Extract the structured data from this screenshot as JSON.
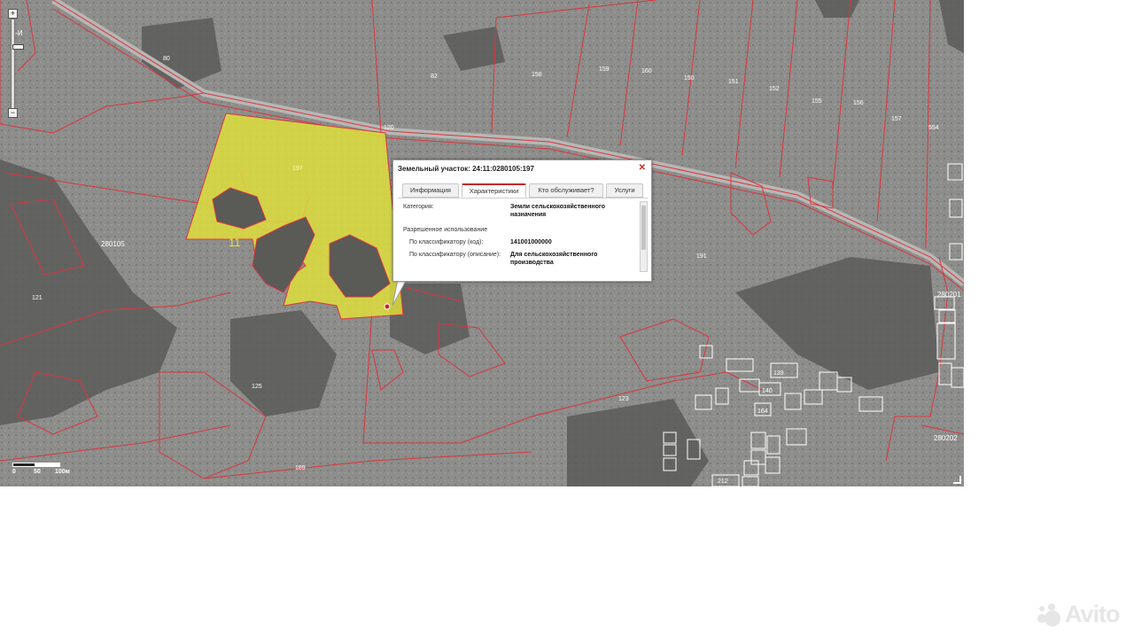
{
  "map": {
    "grid_label": "Б-И",
    "region_labels": [
      "280105",
      "280201",
      "280202"
    ],
    "highlight_number": "11",
    "parcel_labels": [
      "80",
      "82",
      "120",
      "121",
      "123",
      "125",
      "139",
      "140",
      "150",
      "151",
      "152",
      "155",
      "156",
      "157",
      "158",
      "159",
      "160",
      "164",
      "189",
      "191",
      "197",
      "212",
      "554"
    ],
    "scale": {
      "labels": [
        "0",
        "50",
        "100м"
      ]
    },
    "colors": {
      "highlight": "#e2e23a",
      "boundary": "#d9363e",
      "pointer": "#c62828"
    }
  },
  "popup": {
    "title": "Земельный участок: 24:11:0280105:197",
    "close_icon": "close-icon",
    "tabs": [
      "Информация",
      "Характеристики",
      "Кто обслуживает?",
      "Услуги"
    ],
    "active_tab": "Характеристики",
    "rows": {
      "category_label": "Категория:",
      "category_value": "Земли сельскохозяйственного назначения",
      "permitted_label": "Разрешенное использование",
      "classifier_code_label": "По классификатору (код):",
      "classifier_code_value": "141001000000",
      "classifier_desc_label": "По классификатору (описание):",
      "classifier_desc_value": "Для сельскохозяйственного производства"
    }
  },
  "watermark": {
    "text": "Avito"
  }
}
